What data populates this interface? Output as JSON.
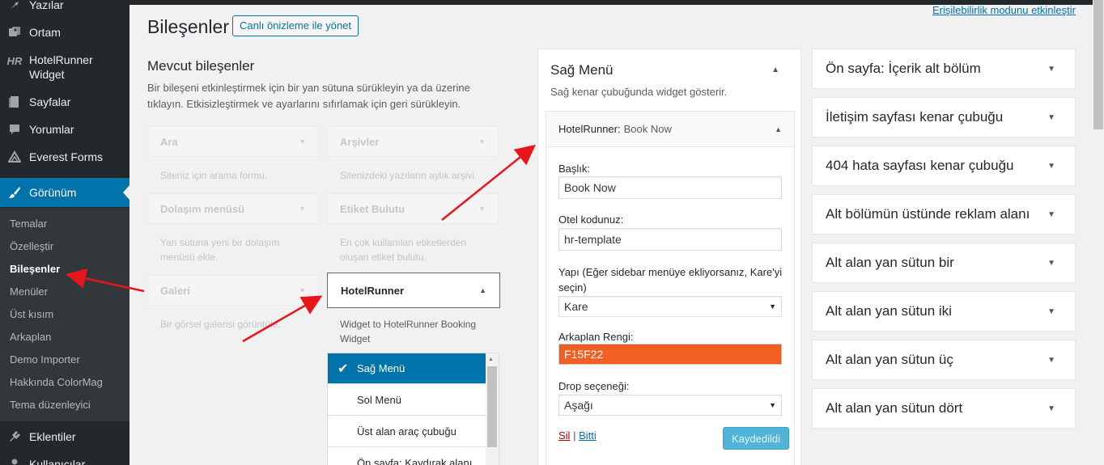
{
  "sidebar": {
    "items": [
      {
        "label": "Yazılar",
        "icon": "pin-icon"
      },
      {
        "label": "Ortam",
        "icon": "media-icon"
      },
      {
        "label": "HotelRunner\nWidget",
        "icon": "hotelrunner-icon"
      },
      {
        "label": "Sayfalar",
        "icon": "pages-icon"
      },
      {
        "label": "Yorumlar",
        "icon": "comments-icon"
      },
      {
        "label": "Everest Forms",
        "icon": "forms-icon"
      },
      {
        "label": "Görünüm",
        "icon": "brush-icon"
      },
      {
        "label": "Eklentiler",
        "icon": "plugin-icon"
      },
      {
        "label": "Kullanıcılar",
        "icon": "users-icon"
      }
    ],
    "submenu": [
      "Temalar",
      "Özelleştir",
      "Bileşenler",
      "Menüler",
      "Üst kısım",
      "Arkaplan",
      "Demo Importer",
      "Hakkında ColorMag",
      "Tema düzenleyici"
    ]
  },
  "header": {
    "title": "Bileşenler",
    "live_button": "Canlı önizleme ile yönet",
    "accessibility_link": "Erişilebilirlik modunu etkinleştir"
  },
  "available": {
    "title": "Mevcut bileşenler",
    "description": "Bir bileşeni etkinleştirmek için bir yan sütuna sürükleyin ya da üzerine tıklayın. Etkisizleştirmek ve ayarlarını sıfırlamak için geri sürükleyin.",
    "widgets": [
      {
        "name": "Ara",
        "desc": "Siteniz için arama formu."
      },
      {
        "name": "Arşivler",
        "desc": "Sitenizdeki yazıların aylık arşivi"
      },
      {
        "name": "Dolaşım menüsü",
        "desc": "Yan sütuna yeni bir dolaşım menüsü ekle."
      },
      {
        "name": "Etiket Bulutu",
        "desc": "En çok kullanılan etiketlerden oluşan etiket bulutu."
      },
      {
        "name": "Galeri",
        "desc": "Bir görsel galerisi görüntüle."
      }
    ],
    "hotelrunner": {
      "name": "HotelRunner",
      "desc": "Widget to HotelRunner Booking Widget"
    },
    "chooser": [
      "Sağ Menü",
      "Sol Menü",
      "Üst alan araç çubuğu",
      "Ön sayfa: Kaydırak alanı"
    ]
  },
  "sag_menu": {
    "title": "Sağ Menü",
    "desc": "Sağ kenar çubuğunda widget gösterir.",
    "widget_name": "HotelRunner:",
    "widget_sub": "Book Now",
    "fields": {
      "baslik_label": "Başlık:",
      "baslik_value": "Book Now",
      "otel_label": "Otel kodunuz:",
      "otel_value": "hr-template",
      "yapi_label": "Yapı (Eğer sidebar menüye ekliyorsanız, Kare'yi seçin)",
      "yapi_value": "Kare",
      "renk_label": "Arkaplan Rengi:",
      "renk_value": "F15F22",
      "drop_label": "Drop seçeneği:",
      "drop_value": "Aşağı"
    },
    "delete_link": "Sil",
    "separator": "|",
    "done_link": "Bitti",
    "save_button": "Kaydedildi"
  },
  "sidebars": [
    "Ön sayfa: İçerik alt bölüm",
    "İletişim sayfası kenar çubuğu",
    "404 hata sayfası kenar çubuğu",
    "Alt bölümün üstünde reklam alanı",
    "Alt alan yan sütun bir",
    "Alt alan yan sütun iki",
    "Alt alan yan sütun üç",
    "Alt alan yan sütun dört"
  ],
  "colors": {
    "accent": "#0073aa",
    "admin_bar": "#23282d",
    "picked_color": "#f15f22",
    "annotation_arrow": "#e8151b"
  }
}
